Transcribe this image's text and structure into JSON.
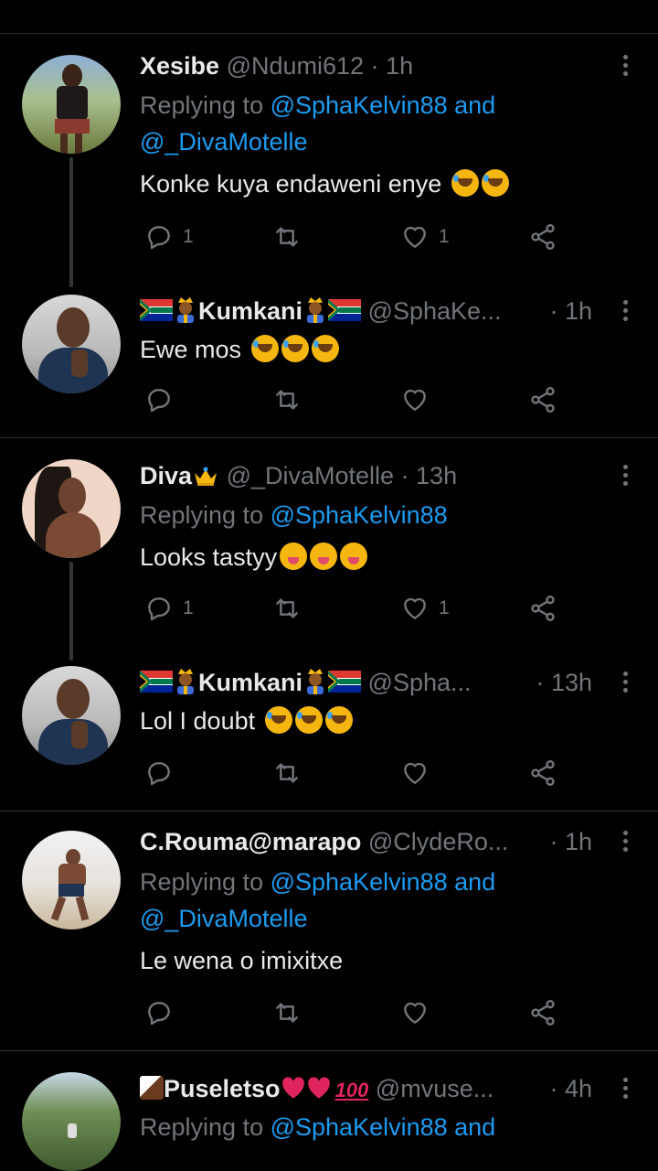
{
  "tweets": [
    {
      "name": "Xesibe",
      "handle": "@Ndumi612 · 1h",
      "time": "",
      "replying_prefix": "Replying to ",
      "replying_line1": "@SphaKelvin88 and",
      "replying_line2": "@_DivaMotelle",
      "text": "Konke kuya endaweni enye",
      "reply_count": "1",
      "retweet_count": "",
      "like_count": "1"
    },
    {
      "name": "Kumkani",
      "handle": "@SphaKe...",
      "time": "· 1h",
      "text": "Ewe mos",
      "reply_count": "",
      "retweet_count": "",
      "like_count": ""
    },
    {
      "name": "Diva",
      "handle": "@_DivaMotelle · 13h",
      "time": "",
      "replying_prefix": "Replying to ",
      "replying_line1": "@SphaKelvin88",
      "text": "Looks tastyy",
      "reply_count": "1",
      "retweet_count": "",
      "like_count": "1"
    },
    {
      "name": "Kumkani",
      "handle": "@Spha...",
      "time": "· 13h",
      "text": "Lol I doubt",
      "reply_count": "",
      "retweet_count": "",
      "like_count": ""
    },
    {
      "name": "C.Rouma@marapo",
      "handle": "@ClydeRo...",
      "time": "· 1h",
      "replying_prefix": "Replying to ",
      "replying_line1": "@SphaKelvin88 and",
      "replying_line2": "@_DivaMotelle",
      "text": "Le wena o imixitxe",
      "reply_count": "",
      "retweet_count": "",
      "like_count": ""
    },
    {
      "name": "Puseletso",
      "handle": "@mvuse...",
      "time": "· 4h",
      "replying_prefix": "Replying to ",
      "replying_line1": "@SphaKelvin88 and"
    }
  ],
  "icons": {
    "reply": "reply-icon",
    "retweet": "retweet-icon",
    "like": "heart-icon",
    "share": "share-icon",
    "more": "more-icon"
  },
  "colors": {
    "background": "#000000",
    "link": "#1d9bf0",
    "muted": "#71767b",
    "text": "#e7e9ea",
    "divider": "#2f3336"
  }
}
